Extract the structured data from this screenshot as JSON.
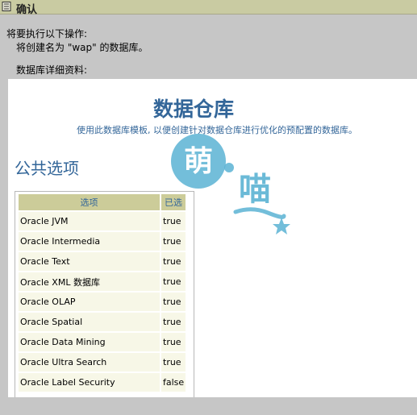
{
  "window": {
    "title": "确认",
    "title_icon": "form-icon"
  },
  "intro": {
    "line1": "将要执行以下操作:",
    "line2": "将创建名为 \"wap\" 的数据库。"
  },
  "detail_label": "数据库详细资料:",
  "document": {
    "title": "数据仓库",
    "subtitle": "使用此数据库模板, 以便创建针对数据仓库进行优化的预配置的数据库。",
    "section_title": "公共选项"
  },
  "table": {
    "headers": [
      "选项",
      "已选"
    ],
    "rows": [
      {
        "option": "Oracle JVM",
        "selected": "true"
      },
      {
        "option": "Oracle Intermedia",
        "selected": "true"
      },
      {
        "option": "Oracle Text",
        "selected": "true"
      },
      {
        "option": "Oracle XML 数据库",
        "selected": "true"
      },
      {
        "option": "Oracle OLAP",
        "selected": "true"
      },
      {
        "option": "Oracle Spatial",
        "selected": "true"
      },
      {
        "option": "Oracle Data Mining",
        "selected": "true"
      },
      {
        "option": "Oracle Ultra Search",
        "selected": "true"
      },
      {
        "option": "Oracle Label Security",
        "selected": "false"
      }
    ]
  },
  "watermark": {
    "char1": "萌",
    "char2": "喵"
  },
  "colors": {
    "title_bar": "#c9cba2",
    "heading_blue": "#336699",
    "table_header": "#cccc99",
    "table_cell": "#f7f7e7",
    "watermark": "#5bb3d3"
  }
}
